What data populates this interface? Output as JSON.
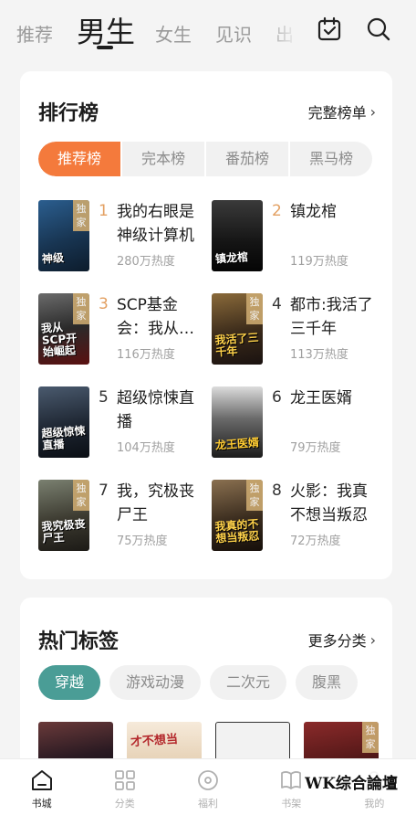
{
  "top_tabs": {
    "tab1": "推荐",
    "tab2": "男生",
    "tab3": "女生",
    "tab4": "见识",
    "tab5": "出"
  },
  "ranking": {
    "title": "排行榜",
    "more": "完整榜单",
    "tabs": [
      "推荐榜",
      "完本榜",
      "番茄榜",
      "黑马榜"
    ],
    "exclusive_badge": "独家",
    "items": [
      {
        "rank": "1",
        "title": "我的右眼是神级计算机",
        "heat": "280万热度",
        "cover_text": "神级"
      },
      {
        "rank": "2",
        "title": "镇龙棺",
        "heat": "119万热度",
        "cover_text": "镇龙棺"
      },
      {
        "rank": "3",
        "title": "SCP基金会：我从…",
        "heat": "116万热度",
        "cover_text": "我从SCP开始崛起"
      },
      {
        "rank": "4",
        "title": "都市:我活了三千年",
        "heat": "113万热度",
        "cover_text": "我活了三千年"
      },
      {
        "rank": "5",
        "title": "超级惊悚直播",
        "heat": "104万热度",
        "cover_text": "超级惊悚直播"
      },
      {
        "rank": "6",
        "title": "龙王医婿",
        "heat": "79万热度",
        "cover_text": "龙王医婿"
      },
      {
        "rank": "7",
        "title": "我，究极丧尸王",
        "heat": "75万热度",
        "cover_text": "我究极丧尸王"
      },
      {
        "rank": "8",
        "title": "火影：我真不想当叛忍",
        "heat": "72万热度",
        "cover_text": "我真的不想当叛忍"
      }
    ]
  },
  "hot_tags": {
    "title": "热门标签",
    "more": "更多分类",
    "tags": [
      "穿越",
      "游戏动漫",
      "二次元",
      "腹黑"
    ],
    "cover_texts": [
      "",
      "才不想当",
      "",
      "独家"
    ]
  },
  "bottom_nav": [
    "书城",
    "分类",
    "福利",
    "书架",
    "我的"
  ],
  "watermark": "WK综合論壇",
  "colors": {
    "accent_orange": "#f47a3c",
    "accent_teal": "#4a9d96",
    "rank_gold": "#e3a062"
  }
}
